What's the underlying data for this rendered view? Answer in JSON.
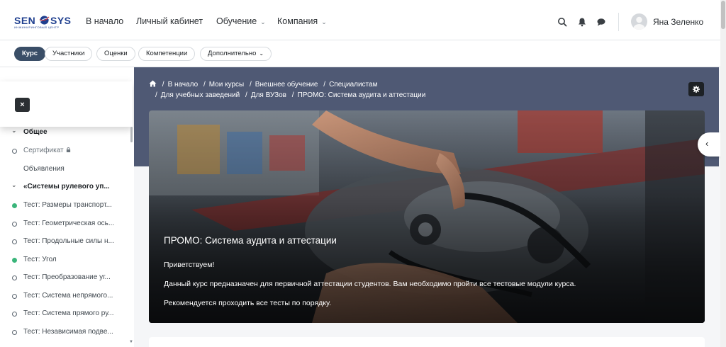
{
  "brand": {
    "left": "SEN",
    "right": "SYS",
    "subtitle": "ИНЖИНИРИНГОВЫЙ ЦЕНТР"
  },
  "topnav": {
    "items": [
      {
        "label": "В начало"
      },
      {
        "label": "Личный кабинет"
      },
      {
        "label": "Обучение"
      },
      {
        "label": "Компания"
      }
    ],
    "user_name": "Яна Зеленко"
  },
  "secondary_nav": {
    "tabs": [
      {
        "label": "Курс",
        "active": true
      },
      {
        "label": "Участники"
      },
      {
        "label": "Оценки"
      },
      {
        "label": "Компетенции"
      },
      {
        "label": "Дополнительно"
      }
    ]
  },
  "sidebar": {
    "close_label": "×",
    "items": [
      {
        "type": "section",
        "label": "Общее"
      },
      {
        "type": "activity",
        "label": "Сертификат",
        "status": "locked"
      },
      {
        "type": "plain",
        "label": "Объявления"
      },
      {
        "type": "section",
        "label": "«Системы рулевого уп..."
      },
      {
        "type": "activity",
        "label": "Тест: Размеры транспорт...",
        "status": "done"
      },
      {
        "type": "activity",
        "label": "Тест: Геометрическая ось...",
        "status": "todo"
      },
      {
        "type": "activity",
        "label": "Тест: Продольные силы н...",
        "status": "todo"
      },
      {
        "type": "activity",
        "label": "Тест: Угол",
        "status": "done"
      },
      {
        "type": "activity",
        "label": "Тест: Преобразование уг...",
        "status": "todo"
      },
      {
        "type": "activity",
        "label": "Тест: Система непрямого...",
        "status": "todo"
      },
      {
        "type": "activity",
        "label": "Тест: Система прямого ру...",
        "status": "todo"
      },
      {
        "type": "activity",
        "label": "Тест: Независимая подве...",
        "status": "todo"
      }
    ]
  },
  "breadcrumb": {
    "line1": [
      "В начало",
      "Мои курсы",
      "Внешнее обучение",
      "Специалистам"
    ],
    "line2": [
      "Для учебных заведений",
      "Для ВУЗов",
      "ПРОМО: Система аудита и аттестации"
    ]
  },
  "hero": {
    "title": "ПРОМО: Система аудита и аттестации",
    "greeting": "Приветствуем!",
    "paragraph1": "Данный курс предназначен для первичной аттестации студентов. Вам необходимо пройти все тестовые модули курса.",
    "paragraph2": "Рекомендуется проходить все тесты по порядку."
  },
  "icons": {
    "search": "search-icon",
    "bell": "bell-icon",
    "messages": "chat-icon",
    "settings": "gear-icon",
    "home": "home-icon",
    "drawer": "chevron-left-icon"
  },
  "colors": {
    "active_pill": "#3a4e67",
    "banner": "#4f5974",
    "complete": "#3ab57a",
    "brand": "#1f3f8f"
  }
}
